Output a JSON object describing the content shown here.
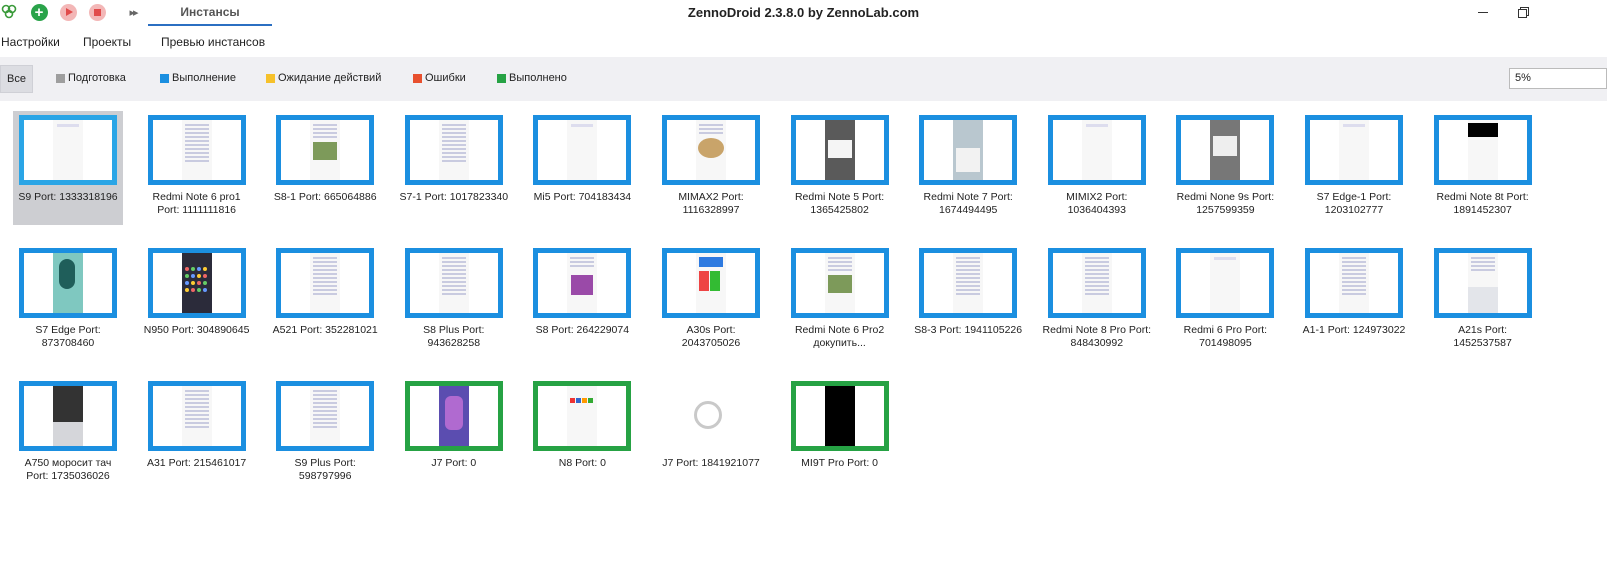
{
  "app": {
    "title": "ZennoDroid 2.3.8.0 by ZennoLab.com",
    "tab": "Инстансы"
  },
  "menu": [
    "Настройки",
    "Проекты",
    "Превью инстансов"
  ],
  "filters": {
    "all": "Все",
    "items": [
      {
        "label": "Подготовка",
        "color": "#9e9e9e"
      },
      {
        "label": "Выполнение",
        "color": "#1b8fe0"
      },
      {
        "label": "Ожидание действий",
        "color": "#f6c12a"
      },
      {
        "label": "Ошибки",
        "color": "#e8502e"
      },
      {
        "label": "Выполнено",
        "color": "#26a244"
      }
    ]
  },
  "zoom": "5%",
  "instances": [
    {
      "name": "S9 Port: 1333318196",
      "status": "selected",
      "screen": "light"
    },
    {
      "name": "Redmi Note 6 pro1 Port: 1111111816",
      "status": "running",
      "screen": "text"
    },
    {
      "name": "S8-1 Port: 665064886",
      "status": "running",
      "screen": "photo"
    },
    {
      "name": "S7-1 Port: 1017823340",
      "status": "running",
      "screen": "text"
    },
    {
      "name": "Mi5 Port: 704183434",
      "status": "running",
      "screen": "light"
    },
    {
      "name": "MIMAX2 Port: 1116328997",
      "status": "running",
      "screen": "food"
    },
    {
      "name": "Redmi Note 5 Port: 1365425802",
      "status": "running",
      "screen": "dark-dialog"
    },
    {
      "name": "Redmi Note 7 Port: 1674494495",
      "status": "running",
      "screen": "blue-grey"
    },
    {
      "name": "MIMIX2 Port: 1036404393",
      "status": "running",
      "screen": "light"
    },
    {
      "name": "Redmi None 9s Port: 1257599359",
      "status": "running",
      "screen": "grey-dialog"
    },
    {
      "name": "S7 Edge-1 Port: 1203102777",
      "status": "running",
      "screen": "light"
    },
    {
      "name": "Redmi Note 8t Port: 1891452307",
      "status": "running",
      "screen": "black-top"
    },
    {
      "name": "S7 Edge Port: 873708460",
      "status": "running",
      "screen": "teal"
    },
    {
      "name": "N950 Port: 304890645",
      "status": "running",
      "screen": "dark-apps"
    },
    {
      "name": "A521 Port: 352281021",
      "status": "running",
      "screen": "text"
    },
    {
      "name": "S8 Plus Port: 943628258",
      "status": "running",
      "screen": "text"
    },
    {
      "name": "S8 Port: 264229074",
      "status": "running",
      "screen": "flower"
    },
    {
      "name": "A30s Port: 2043705026",
      "status": "running",
      "screen": "colorful"
    },
    {
      "name": "Redmi Note 6 Pro2 докупить...",
      "status": "running",
      "screen": "photo"
    },
    {
      "name": "S8-3 Port: 1941105226",
      "status": "running",
      "screen": "text"
    },
    {
      "name": "Redmi Note 8 Pro Port: 848430992",
      "status": "running",
      "screen": "text"
    },
    {
      "name": "Redmi 6 Pro Port: 701498095",
      "status": "running",
      "screen": "light"
    },
    {
      "name": "A1-1 Port: 124973022",
      "status": "running",
      "screen": "text"
    },
    {
      "name": "A21s Port: 1452537587",
      "status": "running",
      "screen": "keyboard"
    },
    {
      "name": "A750 моросит тач Port: 1735036026",
      "status": "running",
      "screen": "dark-keyboard"
    },
    {
      "name": "A31 Port: 215461017",
      "status": "running",
      "screen": "text"
    },
    {
      "name": "S9 Plus Port: 598797996",
      "status": "running",
      "screen": "text"
    },
    {
      "name": "J7 Port: 0",
      "status": "done",
      "screen": "purple"
    },
    {
      "name": "N8 Port: 0",
      "status": "done",
      "screen": "icons"
    },
    {
      "name": "J7 Port: 1841921077",
      "status": "loading",
      "screen": "none"
    },
    {
      "name": "MI9T Pro Port: 0",
      "status": "done",
      "screen": "black"
    }
  ]
}
